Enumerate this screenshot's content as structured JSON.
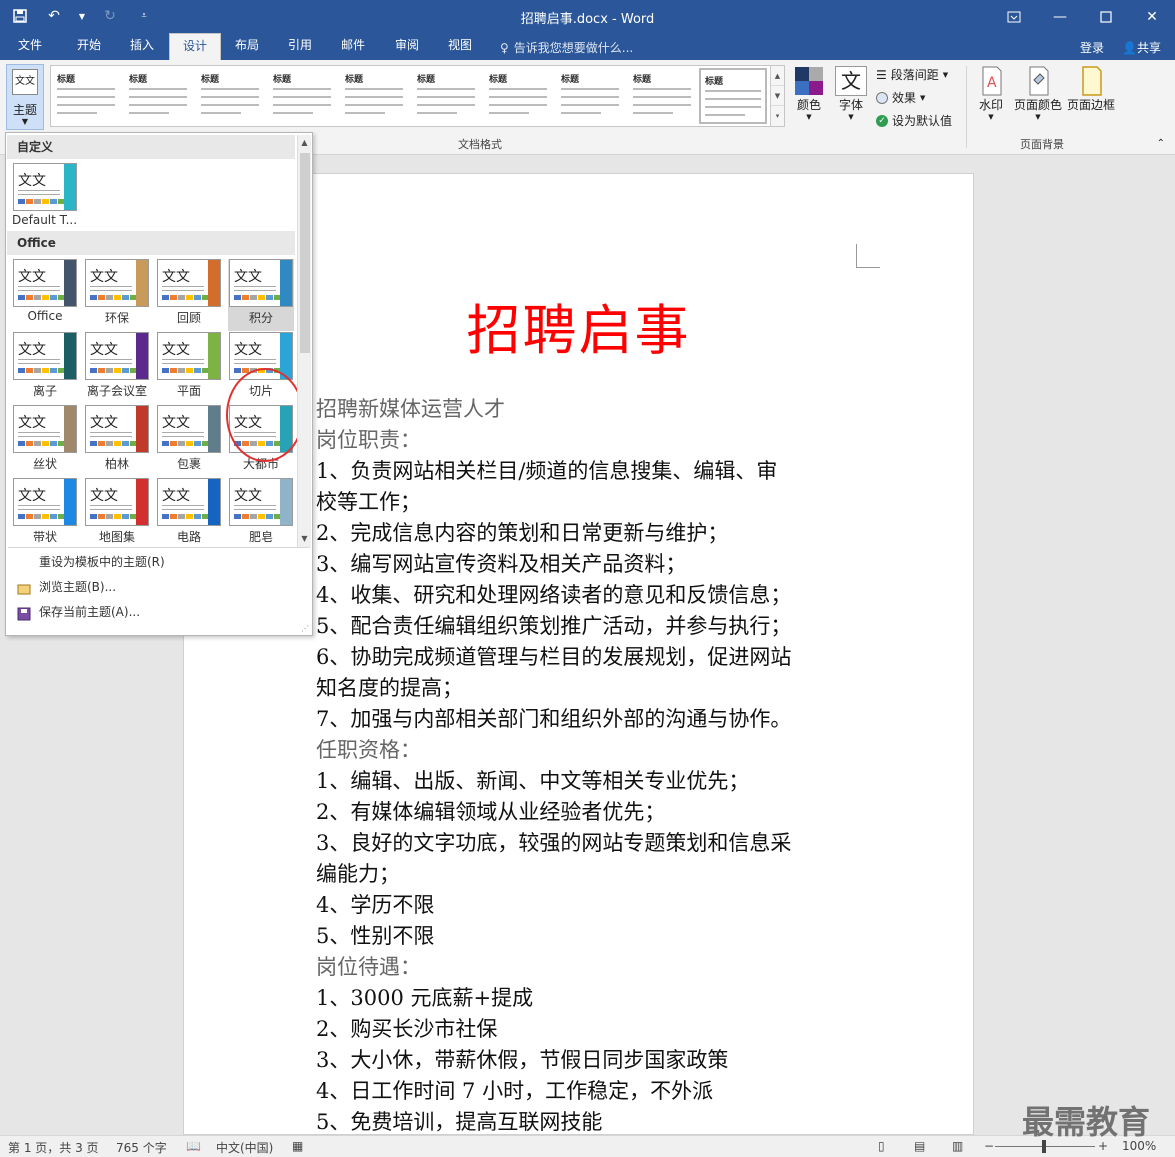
{
  "window": {
    "title": "招聘启事.docx - Word"
  },
  "tabs": [
    "文件",
    "开始",
    "插入",
    "设计",
    "布局",
    "引用",
    "邮件",
    "审阅",
    "视图"
  ],
  "active_tab": "设计",
  "tellme": "告诉我您想要做什么...",
  "account": {
    "login": "登录",
    "share": "共享"
  },
  "ribbon": {
    "theme_label": "主题",
    "theme_icon_text": "文文",
    "gallery_thumb_title": "标题",
    "colors_label": "颜色",
    "fonts_label": "字体",
    "fonts_icon_text": "文",
    "paragraph_spacing": "段落间距",
    "effects": "效果",
    "set_default": "设为默认值",
    "watermark": "水印",
    "page_color": "页面颜色",
    "page_border": "页面边框",
    "group_doc_format": "文档格式",
    "group_page_bg": "页面背景"
  },
  "dropdown": {
    "custom_header": "自定义",
    "custom_item": "Default T...",
    "office_header": "Office",
    "swatch_text": "文文",
    "themes": [
      {
        "name": "Office",
        "accent": "#44546a"
      },
      {
        "name": "环保",
        "accent": "#c89b5b"
      },
      {
        "name": "回顾",
        "accent": "#d36d2b"
      },
      {
        "name": "积分",
        "accent": "#2f8ac4"
      },
      {
        "name": "离子",
        "accent": "#1b5e63"
      },
      {
        "name": "离子会议室",
        "accent": "#5b2a8c"
      },
      {
        "name": "平面",
        "accent": "#7cb342"
      },
      {
        "name": "切片",
        "accent": "#2ba5d8"
      },
      {
        "name": "丝状",
        "accent": "#a0896b"
      },
      {
        "name": "柏林",
        "accent": "#c0392b"
      },
      {
        "name": "包裹",
        "accent": "#607d8b"
      },
      {
        "name": "大都市",
        "accent": "#28a3b5"
      },
      {
        "name": "带状",
        "accent": "#1e88e5"
      },
      {
        "name": "地图集",
        "accent": "#d32f2f"
      },
      {
        "name": "电路",
        "accent": "#1565c0"
      },
      {
        "name": "肥皂",
        "accent": "#8fb4c8"
      }
    ],
    "highlighted_theme": "积分",
    "menu": [
      "重设为模板中的主题(R)",
      "浏览主题(B)...",
      "保存当前主题(A)..."
    ]
  },
  "document": {
    "title": "招聘启事",
    "lines": [
      {
        "text": "招聘新媒体运营人才",
        "style": "h"
      },
      {
        "text": "岗位职责：",
        "style": "h"
      },
      {
        "text": "1、负责网站相关栏目/频道的信息搜集、编辑、审",
        "style": "p"
      },
      {
        "text": "校等工作；",
        "style": "p"
      },
      {
        "text": "2、完成信息内容的策划和日常更新与维护；",
        "style": "p"
      },
      {
        "text": "3、编写网站宣传资料及相关产品资料；",
        "style": "p"
      },
      {
        "text": "4、收集、研究和处理网络读者的意见和反馈信息；",
        "style": "p"
      },
      {
        "text": "5、配合责任编辑组织策划推广活动，并参与执行；",
        "style": "p"
      },
      {
        "text": "6、协助完成频道管理与栏目的发展规划，促进网站",
        "style": "p"
      },
      {
        "text": "知名度的提高；",
        "style": "p"
      },
      {
        "text": "7、加强与内部相关部门和组织外部的沟通与协作。",
        "style": "p"
      },
      {
        "text": "任职资格：",
        "style": "h"
      },
      {
        "text": "1、编辑、出版、新闻、中文等相关专业优先；",
        "style": "p"
      },
      {
        "text": "2、有媒体编辑领域从业经验者优先；",
        "style": "p"
      },
      {
        "text": "3、良好的文字功底，较强的网站专题策划和信息采",
        "style": "p"
      },
      {
        "text": "编能力；",
        "style": "p"
      },
      {
        "text": "4、学历不限",
        "style": "p"
      },
      {
        "text": "5、性别不限",
        "style": "p"
      },
      {
        "text": "岗位待遇：",
        "style": "h"
      },
      {
        "text": "1、3000 元底薪+提成",
        "style": "p"
      },
      {
        "text": "2、购买长沙市社保",
        "style": "p"
      },
      {
        "text": "3、大小休，带薪休假，节假日同步国家政策",
        "style": "p"
      },
      {
        "text": "4、日工作时间 7 小时，工作稳定，不外派",
        "style": "p"
      },
      {
        "text": "5、免费培训，提高互联网技能",
        "style": "p"
      }
    ]
  },
  "status": {
    "page": "第 1 页，共 3 页",
    "words": "765 个字",
    "language": "中文(中国)",
    "zoom": "100%"
  },
  "watermark_text": "最需教育",
  "colors": {
    "brand": "#2b579a",
    "title_red": "#ff0000",
    "circle": "#e03030"
  }
}
